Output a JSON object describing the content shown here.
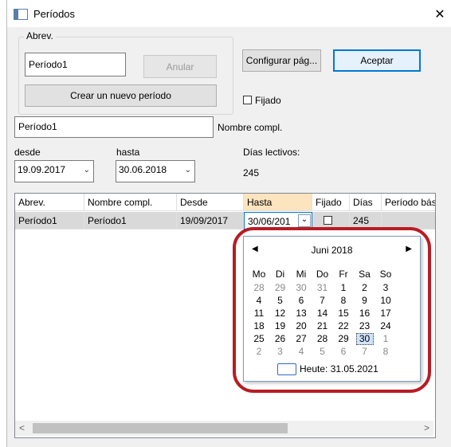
{
  "window": {
    "title": "Períodos",
    "close_glyph": "✕"
  },
  "abrev_group": {
    "legend": "Abrev.",
    "value": "Período1",
    "anular_label": "Anular",
    "create_label": "Crear un nuevo período"
  },
  "buttons": {
    "configurar": "Configurar pág...",
    "aceptar": "Aceptar"
  },
  "fijado": {
    "label": "Fijado",
    "checked": false
  },
  "nombre": {
    "value": "Período1",
    "label": "Nombre compl."
  },
  "desde": {
    "label": "desde",
    "value": "19.09.2017"
  },
  "hasta": {
    "label": "hasta",
    "value": "30.06.2018"
  },
  "dias": {
    "label": "Días lectivos:",
    "value": "245"
  },
  "table": {
    "headers": [
      "Abrev.",
      "Nombre compl.",
      "Desde",
      "Hasta",
      "Fijado",
      "Días",
      "Período bás"
    ],
    "row": [
      "Período1",
      "Período1",
      "19/09/2017",
      "30/06/201",
      "",
      "245",
      ""
    ]
  },
  "calendar": {
    "month": "Juni 2018",
    "weekdays": [
      "Mo",
      "Di",
      "Mi",
      "Do",
      "Fr",
      "Sa",
      "So"
    ],
    "weeks": [
      [
        "28",
        "29",
        "30",
        "31",
        "1",
        "2",
        "3"
      ],
      [
        "4",
        "5",
        "6",
        "7",
        "8",
        "9",
        "10"
      ],
      [
        "11",
        "12",
        "13",
        "14",
        "15",
        "16",
        "17"
      ],
      [
        "18",
        "19",
        "20",
        "21",
        "22",
        "23",
        "24"
      ],
      [
        "25",
        "26",
        "27",
        "28",
        "29",
        "30",
        "1"
      ],
      [
        "2",
        "3",
        "4",
        "5",
        "6",
        "7",
        "8"
      ]
    ],
    "selected": "30",
    "today_label": "Heute: 31.05.2021"
  },
  "scroll": {
    "left_glyph": "<",
    "right_glyph": ">"
  },
  "colors": {
    "accent": "#0078d7",
    "highlight_ring": "#b81c24",
    "selection": "#cfe3fa"
  }
}
